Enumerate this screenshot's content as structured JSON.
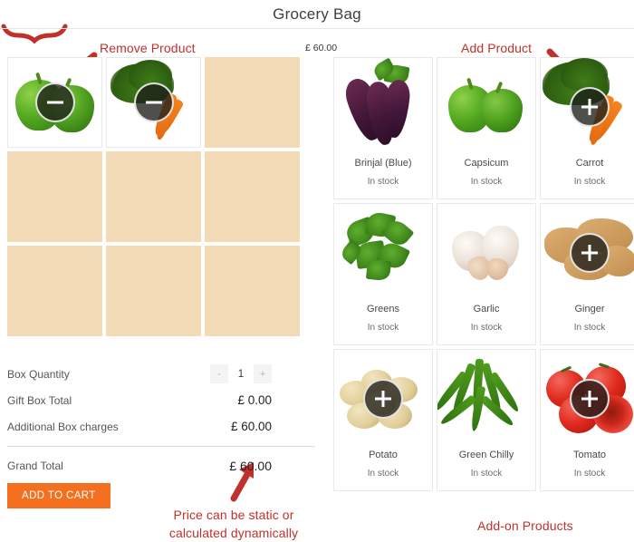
{
  "header": {
    "title": "Grocery Bag"
  },
  "bag": {
    "price_top": "£ 60.00",
    "cells": [
      {
        "name": "Capsicum",
        "filled": true,
        "art": "capsicum",
        "action": "remove"
      },
      {
        "name": "Carrot",
        "filled": true,
        "art": "carrot",
        "action": "remove"
      },
      {
        "name": "",
        "filled": false,
        "art": "",
        "action": ""
      },
      {
        "name": "",
        "filled": false,
        "art": "",
        "action": ""
      },
      {
        "name": "",
        "filled": false,
        "art": "",
        "action": ""
      },
      {
        "name": "",
        "filled": false,
        "art": "",
        "action": ""
      },
      {
        "name": "",
        "filled": false,
        "art": "",
        "action": ""
      },
      {
        "name": "",
        "filled": false,
        "art": "",
        "action": ""
      },
      {
        "name": "",
        "filled": false,
        "art": "",
        "action": ""
      }
    ]
  },
  "totals": {
    "box_quantity_label": "Box Quantity",
    "quantity_value": "1",
    "decrement_label": "-",
    "increment_label": "+",
    "gift_box_total_label": "Gift Box Total",
    "gift_box_total_value": "£ 0.00",
    "additional_charges_label": "Additional Box charges",
    "additional_charges_value": "£ 60.00",
    "grand_total_label": "Grand Total",
    "grand_total_value": "£ 60.00",
    "add_to_cart_label": "ADD TO CART"
  },
  "catalogue": {
    "stock_label": "In stock",
    "products": [
      {
        "name": "Brinjal (Blue)",
        "stock": "In stock",
        "art": "brinjal",
        "has_plus": false
      },
      {
        "name": "Capsicum",
        "stock": "In stock",
        "art": "capsicum",
        "has_plus": false
      },
      {
        "name": "Carrot",
        "stock": "In stock",
        "art": "carrot",
        "has_plus": true
      },
      {
        "name": "Greens",
        "stock": "In stock",
        "art": "greens",
        "has_plus": false
      },
      {
        "name": "Garlic",
        "stock": "In stock",
        "art": "garlic",
        "has_plus": false
      },
      {
        "name": "Ginger",
        "stock": "In stock",
        "art": "ginger",
        "has_plus": true
      },
      {
        "name": "Potato",
        "stock": "In stock",
        "art": "potato",
        "has_plus": true
      },
      {
        "name": "Green Chilly",
        "stock": "In stock",
        "art": "chilly",
        "has_plus": false
      },
      {
        "name": "Tomato",
        "stock": "In stock",
        "art": "tomato",
        "has_plus": true
      }
    ]
  },
  "annotations": {
    "remove_product": "Remove Product",
    "add_product": "Add Product",
    "price_note": "Price can be static or calculated dynamically",
    "addon_products": "Add-on Products",
    "color": "#c0312b"
  },
  "colors": {
    "accent_orange": "#f4701f",
    "empty_cell_tan": "#f3dbb8",
    "annotation_red": "#c0312b",
    "card_border": "#e9e9e9"
  }
}
